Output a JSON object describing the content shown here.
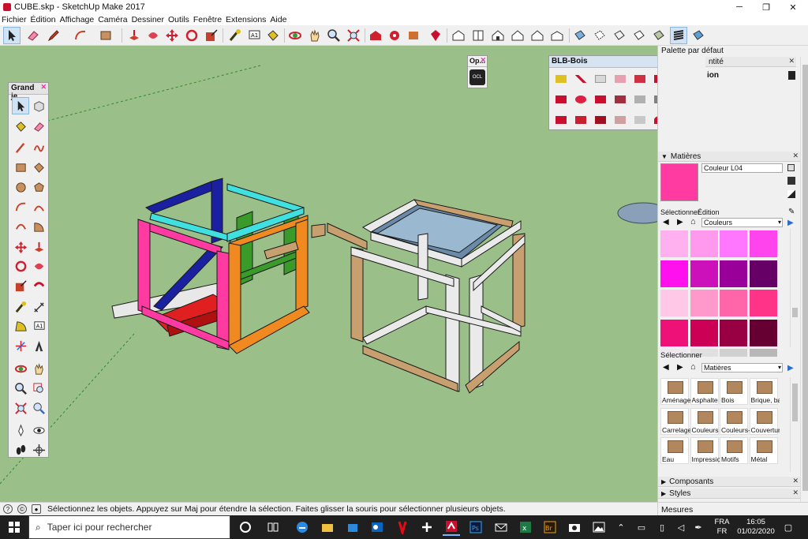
{
  "window": {
    "title": "CUBE.skp - SketchUp Make 2017",
    "minimize": "─",
    "maximize": "❐",
    "close": "✕"
  },
  "menu": [
    "Fichier",
    "Édition",
    "Affichage",
    "Caméra",
    "Dessiner",
    "Outils",
    "Fenêtre",
    "Extensions",
    "Aide"
  ],
  "toolbar_icons": [
    "select-icon",
    "eraser-icon",
    "pencil-icon",
    "arc-icon",
    "rectangle-icon",
    "push-pull-icon",
    "follow-me-icon",
    "move-icon",
    "rotate-icon",
    "scale-icon",
    "tape-icon",
    "text-icon",
    "paint-bucket-icon",
    "orbit-icon",
    "pan-icon",
    "zoom-icon",
    "zoom-extents-icon",
    "warehouse-icon",
    "extension-warehouse-icon",
    "ruby-icon",
    "iso-view-icon",
    "top-view-icon",
    "front-view-icon",
    "right-view-icon",
    "back-view-icon",
    "left-view-icon",
    "xray-icon",
    "back-edges-icon",
    "wireframe-icon",
    "hidden-line-icon",
    "shaded-icon",
    "textured-icon",
    "monochrome-icon"
  ],
  "tools_palette": {
    "title": "Grand je...",
    "close": "✕"
  },
  "ocl_palette": {
    "title": "Op...",
    "button": "OCL",
    "close": "✕"
  },
  "blb_palette": {
    "title": "BLB-Bois",
    "close": "✕"
  },
  "right_panel": {
    "default_tray": "Palette par défaut",
    "entity_tab": "ntité",
    "entity_sub": "ion",
    "materials": {
      "header": "Matières",
      "material_name": "Couleur L04",
      "current_color": "#ff3aa0",
      "tab_select": "Sélectionner",
      "tab_edit": "Édition",
      "library": "Couleurs",
      "colors": [
        "#ffb0ee",
        "#ff99ee",
        "#ff77ff",
        "#ff44ee",
        "#ff11ee",
        "#cc11bb",
        "#990099",
        "#660066",
        "#ffc8e6",
        "#ff99cc",
        "#ff66aa",
        "#ff3388",
        "#ee1177",
        "#cc0055",
        "#990044",
        "#660033"
      ],
      "second_select": "Sélectionner",
      "second_library": "Matières",
      "folders": [
        "Aménage",
        "Asphalte",
        "Bois",
        "Brique, ba",
        "Carrelage",
        "Couleurs",
        "Couleurs-",
        "Couvertur",
        "Eau",
        "Impressio",
        "Motifs",
        "Métal"
      ]
    },
    "components": "Composants",
    "styles": "Styles"
  },
  "status": {
    "text": "Sélectionnez les objets. Appuyez sur Maj pour étendre la sélection. Faites glisser la souris pour sélectionner plusieurs objets.",
    "measures": "Mesures"
  },
  "taskbar": {
    "search_placeholder": "Taper ici pour rechercher",
    "lang_top": "FRA",
    "lang_bottom": "FR",
    "time": "16:05",
    "date": "01/02/2020"
  }
}
